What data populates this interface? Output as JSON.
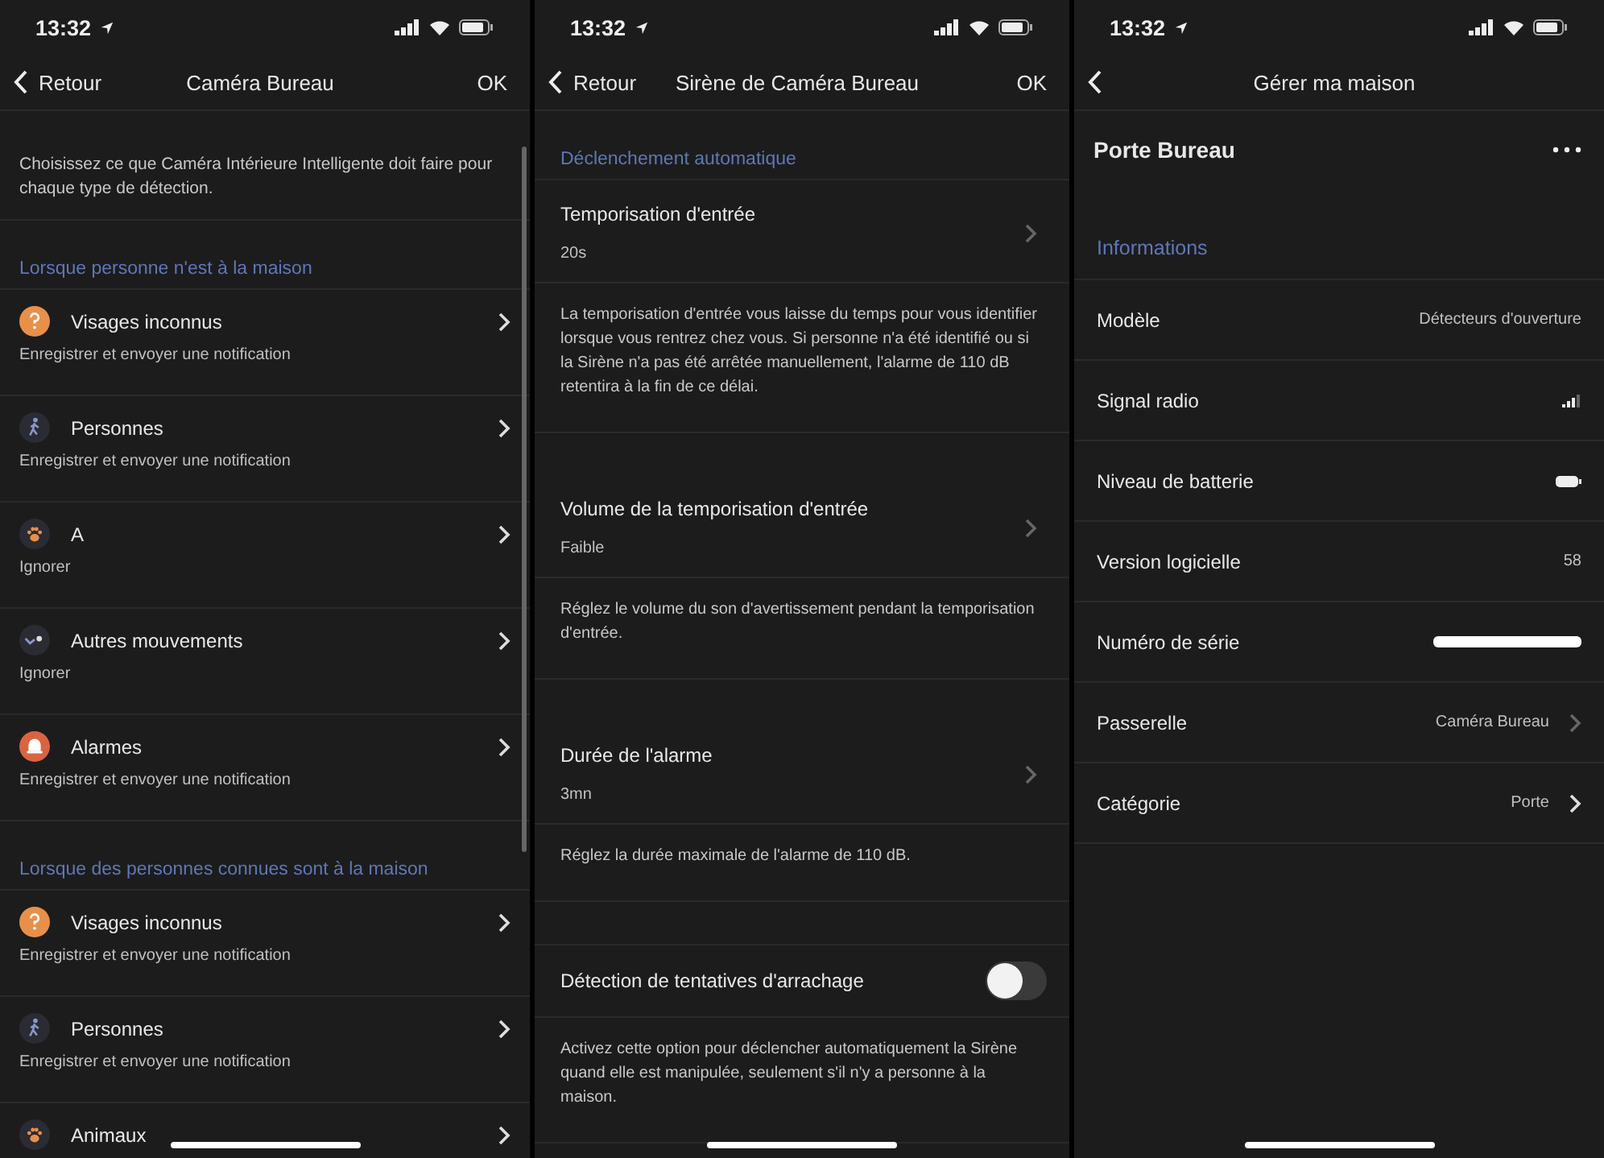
{
  "detection_screen": {
    "status_bar": {
      "time": "13:32"
    },
    "nav": {
      "back": "Retour",
      "title": "Caméra Bureau",
      "action": "OK"
    },
    "description": "Choisissez ce que Caméra Intérieure Intelligente doit faire pour chaque type de détection.",
    "sections": [
      {
        "header": "Lorsque personne n'est à la maison",
        "items": [
          {
            "kind": "question",
            "title": "Visages inconnus",
            "subtitle": "Enregistrer et envoyer une notification"
          },
          {
            "kind": "walker",
            "title": "Personnes",
            "subtitle": "Enregistrer et envoyer une notification"
          },
          {
            "kind": "paw",
            "title": "A",
            "subtitle": "Ignorer"
          },
          {
            "kind": "motion",
            "title": "Autres mouvements",
            "subtitle": "Ignorer"
          },
          {
            "kind": "alarm",
            "title": "Alarmes",
            "subtitle": "Enregistrer et envoyer une notification"
          }
        ]
      },
      {
        "header": "Lorsque des personnes connues sont à la maison",
        "items": [
          {
            "kind": "question",
            "title": "Visages inconnus",
            "subtitle": "Enregistrer et envoyer une notification"
          },
          {
            "kind": "walker",
            "title": "Personnes",
            "subtitle": "Enregistrer et envoyer une notification"
          },
          {
            "kind": "paw",
            "title": "Animaux"
          }
        ]
      }
    ]
  },
  "siren_screen": {
    "status_bar": {
      "time": "13:32"
    },
    "nav": {
      "back": "Retour",
      "title": "Sirène de Caméra Bureau",
      "action": "OK"
    },
    "section_header": "Déclenchement automatique",
    "items": [
      {
        "kind": "setting",
        "title": "Temporisation d'entrée",
        "value": "20s"
      },
      {
        "kind": "note",
        "text": "La temporisation d'entrée vous laisse du temps pour vous identifier lorsque vous rentrez chez vous. Si personne n'a été identifié ou si la Sirène n'a pas été arrêtée manuellement, l'alarme de 110 dB retentira à la fin de ce délai."
      },
      {
        "kind": "setting",
        "title": "Volume de la temporisation d'entrée",
        "value": "Faible"
      },
      {
        "kind": "note",
        "text": "Réglez le volume du son d'avertissement pendant la temporisation d'entrée."
      },
      {
        "kind": "setting",
        "title": "Durée de l'alarme",
        "value": "3mn"
      },
      {
        "kind": "note",
        "text": "Réglez la durée maximale de l'alarme de 110 dB."
      },
      {
        "kind": "toggle",
        "title": "Détection de tentatives d'arrachage",
        "on": false
      },
      {
        "kind": "note",
        "text": "Activez cette option pour déclencher automatiquement la Sirène quand elle est manipulée, seulement s'il n'y a personne à la maison."
      }
    ]
  },
  "device_screen": {
    "status_bar": {
      "time": "13:32"
    },
    "nav": {
      "title": "Gérer ma maison"
    },
    "device_name": "Porte Bureau",
    "section_header": "Informations",
    "rows": [
      {
        "kind": "text",
        "label": "Modèle",
        "value": "Détecteurs d'ouverture"
      },
      {
        "kind": "signal",
        "label": "Signal radio"
      },
      {
        "kind": "battery",
        "label": "Niveau de batterie"
      },
      {
        "kind": "text",
        "label": "Version logicielle",
        "value": "58"
      },
      {
        "kind": "redacted",
        "label": "Numéro de série"
      },
      {
        "kind": "link",
        "label": "Passerelle",
        "value": "Caméra Bureau",
        "emphasis": false
      },
      {
        "kind": "link",
        "label": "Catégorie",
        "value": "Porte",
        "emphasis": true
      }
    ]
  }
}
